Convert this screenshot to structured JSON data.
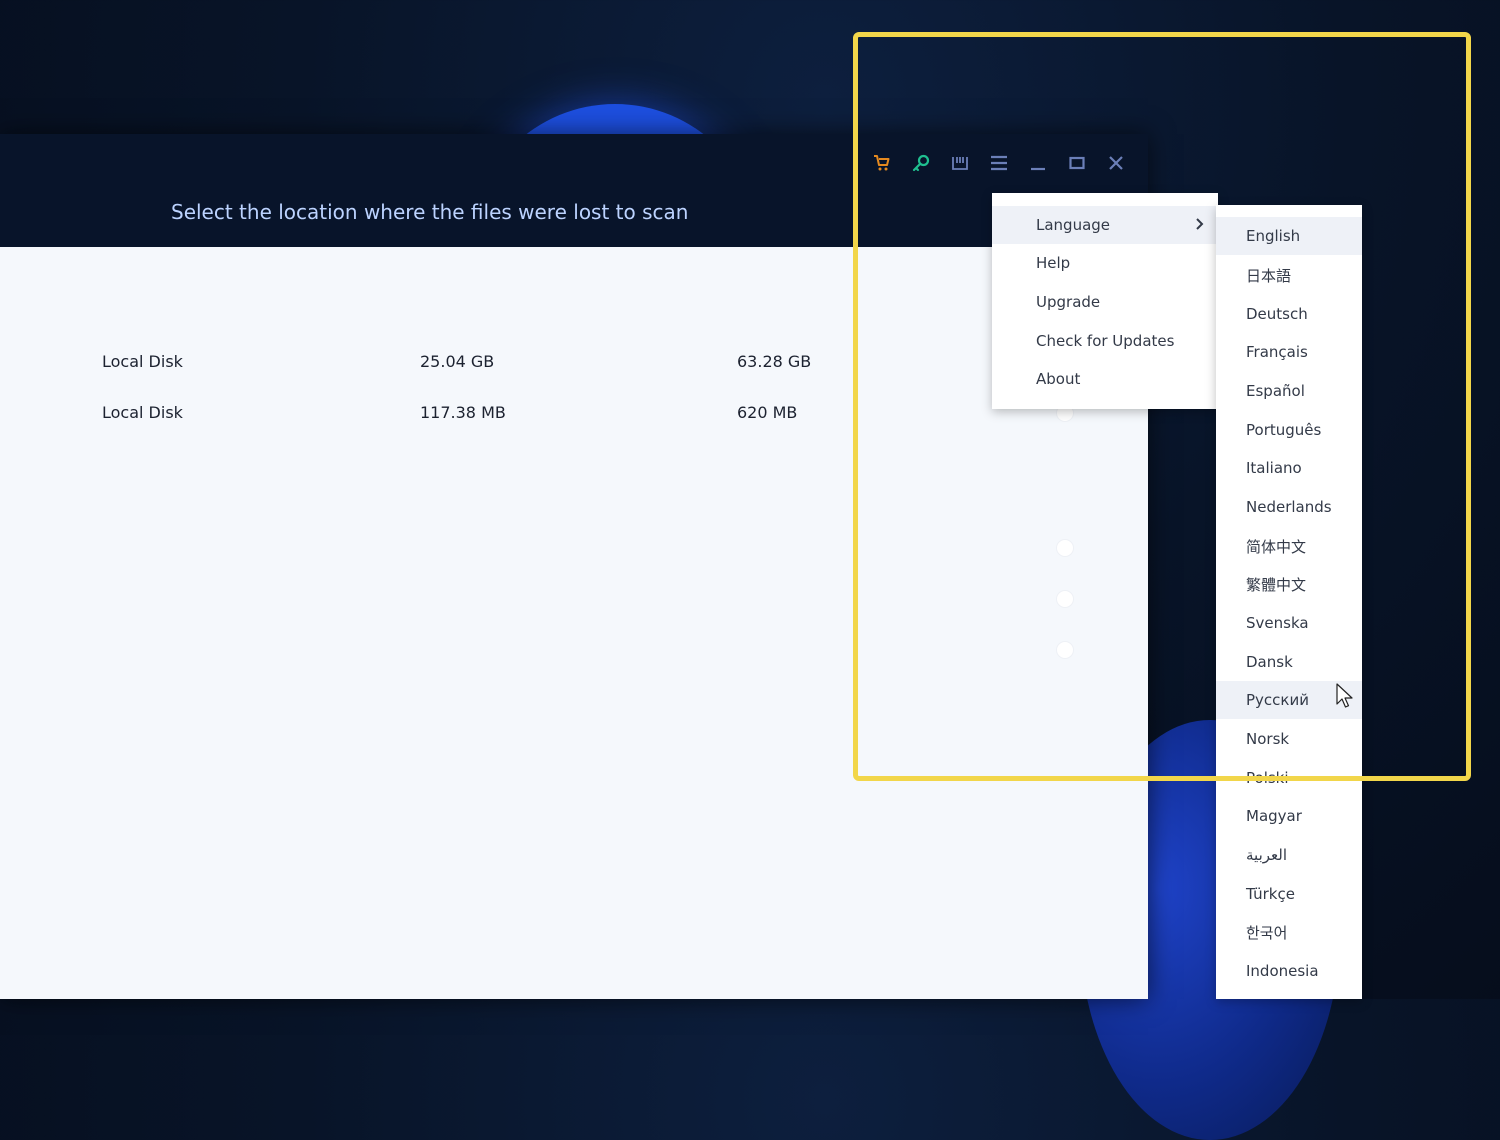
{
  "window": {
    "title": "Select the location where the files were lost to scan"
  },
  "toolbar": {
    "icons": [
      "cart-icon",
      "key-icon",
      "save-icon",
      "menu-icon",
      "minimize-icon",
      "maximize-icon",
      "close-icon"
    ]
  },
  "drives": [
    {
      "name": "Local Disk",
      "used": "25.04 GB",
      "total": "63.28 GB"
    },
    {
      "name": "Local Disk",
      "used": "117.38 MB",
      "total": "620 MB"
    }
  ],
  "menu": {
    "items": [
      "Language",
      "Help",
      "Upgrade",
      "Check for Updates",
      "About"
    ]
  },
  "languages": {
    "selected": "English",
    "hovered": "Русский",
    "items": [
      "English",
      "日本語",
      "Deutsch",
      "Français",
      "Español",
      "Português",
      "Italiano",
      "Nederlands",
      "简体中文",
      "繁體中文",
      "Svenska",
      "Dansk",
      "Русский",
      "Norsk",
      "Polski",
      "Magyar",
      "العربية",
      "Türkçe",
      "한국어",
      "Indonesia"
    ]
  },
  "colors": {
    "highlight": "#f2d64a",
    "titlebar": "#08142a",
    "title_text": "#bcd3ff",
    "cart": "#e68a1f",
    "key": "#1fbf8f",
    "toolbar_icon": "#6b7fb8"
  }
}
